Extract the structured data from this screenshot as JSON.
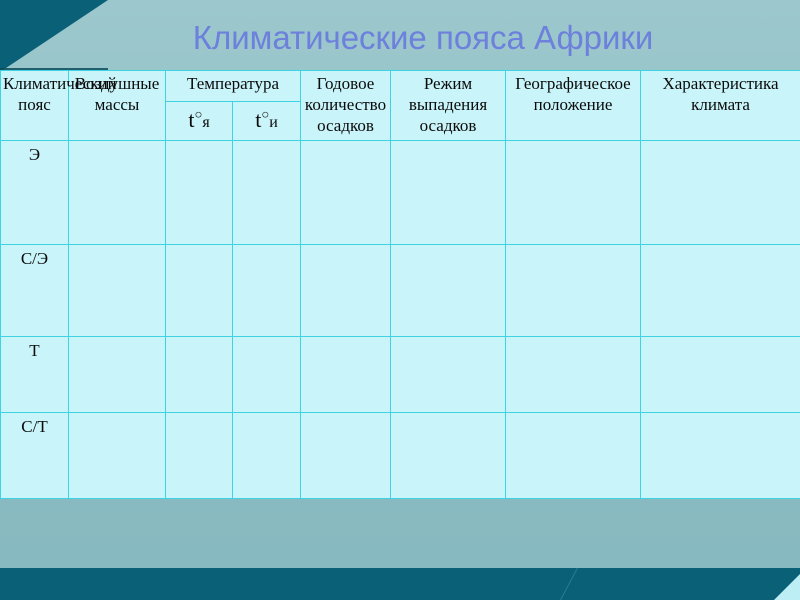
{
  "slide": {
    "title": "Климатические пояса Африки",
    "background_color": "#8fbfc5",
    "accent_color": "#0a6077",
    "title_color": "#6d80dc",
    "table_cell_color": "#c9f4f9",
    "table_gridline_color": "#3fd2e0"
  },
  "table": {
    "headers": {
      "climate_zone": "Климатический пояс",
      "air_masses": "Воздушные массы",
      "temperature": "Температура",
      "temperature_january": "t°я",
      "temperature_july": "t°и",
      "annual_precipitation": "Годовое количество осадков",
      "precipitation_regime": "Режим выпадения осадков",
      "geographic_position": "Географическое положение",
      "climate_characteristics": "Характеристика климата"
    },
    "rows": [
      {
        "zone": "Э",
        "air_masses": "",
        "t_january": "",
        "t_july": "",
        "annual_precipitation": "",
        "precipitation_regime": "",
        "geographic_position": "",
        "climate_characteristics": ""
      },
      {
        "zone": "С/Э",
        "air_masses": "",
        "t_january": "",
        "t_july": "",
        "annual_precipitation": "",
        "precipitation_regime": "",
        "geographic_position": "",
        "climate_characteristics": ""
      },
      {
        "zone": "Т",
        "air_masses": "",
        "t_january": "",
        "t_july": "",
        "annual_precipitation": "",
        "precipitation_regime": "",
        "geographic_position": "",
        "climate_characteristics": ""
      },
      {
        "zone": "С/Т",
        "air_masses": "",
        "t_january": "",
        "t_july": "",
        "annual_precipitation": "",
        "precipitation_regime": "",
        "geographic_position": "",
        "climate_characteristics": ""
      }
    ]
  }
}
